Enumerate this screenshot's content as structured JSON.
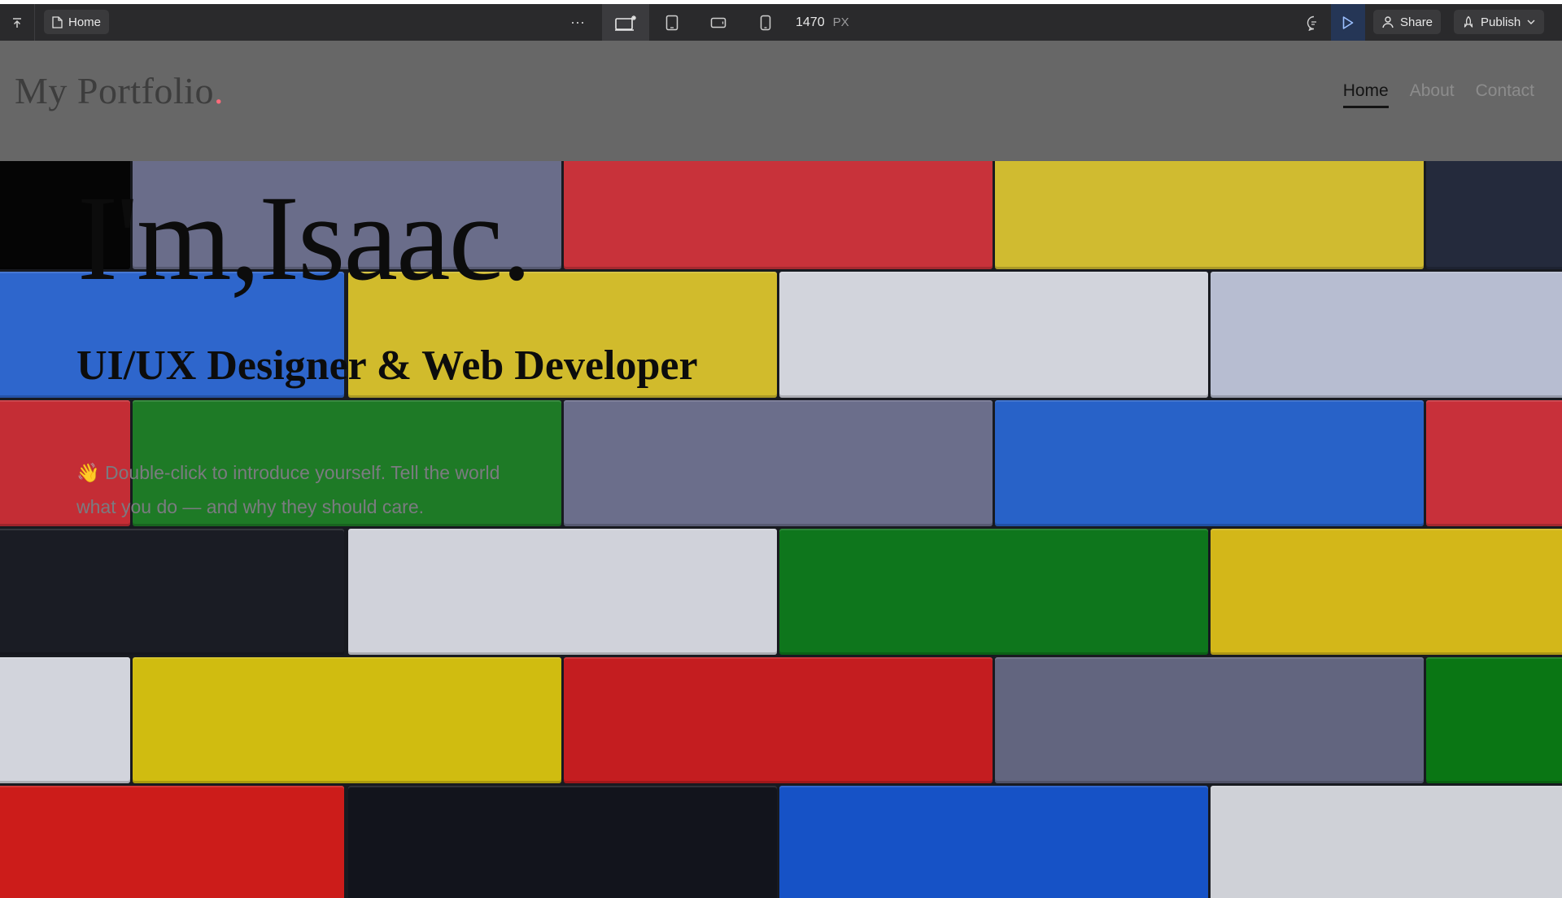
{
  "toolbar": {
    "page_name": "Home",
    "more_label": "···",
    "width_value": "1470",
    "width_unit": "PX",
    "share_label": "Share",
    "publish_label": "Publish",
    "icons": [
      "collapse-icon",
      "page-icon",
      "desktop-icon",
      "tablet-icon",
      "tablet-landscape-icon",
      "phone-icon",
      "comment-icon",
      "play-icon",
      "user-icon",
      "publish-icon",
      "chevron-down-icon"
    ]
  },
  "site": {
    "logo_text": "My Portfolio",
    "logo_dot": ".",
    "logo_dot_color": "#ff6b7a",
    "nav": {
      "home": "Home",
      "about": "About",
      "contact": "Contact"
    },
    "hero": {
      "title": "I'm,Isaac.",
      "subtitle": "UI/UX Designer & Web Developer",
      "intro": "👋 Double-click to introduce yourself. Tell the world what you do — and why they should care."
    }
  },
  "colors": {
    "toolbar_bg": "#2a2a2c",
    "header_bg": "#676767",
    "brick_red": "#c8262a",
    "brick_yellow": "#d4bd16",
    "brick_blue": "#2462c8",
    "brick_green": "#167a1e",
    "brick_grey": "#6a6d8a",
    "brick_white": "#d2d4dc",
    "brick_black": "#1a1c24"
  }
}
